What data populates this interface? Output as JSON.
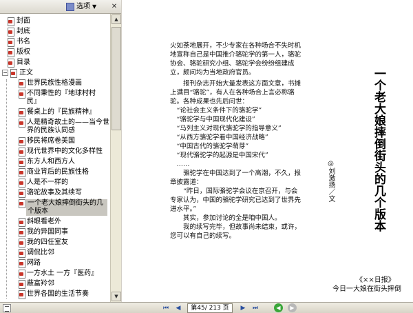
{
  "sidebar": {
    "options_label": "选项",
    "items": [
      {
        "label": "封面"
      },
      {
        "label": "封底"
      },
      {
        "label": "书名"
      },
      {
        "label": "版权"
      },
      {
        "label": "目录"
      },
      {
        "label": "正文"
      },
      {
        "label": "世界民族性格漫画"
      },
      {
        "label": "不同秉性的『地球村村民』"
      },
      {
        "label": "餐桌上的『民族精神』"
      },
      {
        "label": "人是精奇故土的——当今世界的民族认同感"
      },
      {
        "label": "移民将席卷美国"
      },
      {
        "label": "现代世界中的文化多样性"
      },
      {
        "label": "东方人和西方人"
      },
      {
        "label": "商业背后的民族性格"
      },
      {
        "label": "人是不一样的"
      },
      {
        "label": "骆驼故事及其续写"
      },
      {
        "label": "一个老大娘摔倒街头的几个版本"
      },
      {
        "label": "斜眼看老外"
      },
      {
        "label": "我的异国同事"
      },
      {
        "label": "我的四任室友"
      },
      {
        "label": "调侃比邻"
      },
      {
        "label": "网路"
      },
      {
        "label": "一方水土 一方『医药』"
      },
      {
        "label": "蔽富羚邻"
      },
      {
        "label": "世界各国的生活节奏"
      }
    ]
  },
  "document": {
    "paragraphs": [
      {
        "text": "火如荼地展开，不少专家在各种场合不失时机地宣称自己是中国推介骆驼学的第一人，骆驼协会、骆驼研究小组、骆驼学会纷纷组建成立，颇问均为当地政府官员。",
        "style": "plain"
      },
      {
        "text": "报刊杂志开始大量发表这方面文章，书摊上满目“骆驼”，有人在各种场合上言必称骆驼。各种成果也先后问世：",
        "style": "ind"
      },
      {
        "text": "“论社会主义条件下的骆驼学”",
        "style": "q"
      },
      {
        "text": "“骆驼学与中国现代化建设”",
        "style": "q"
      },
      {
        "text": "“马列主义对现代骆驼学的指导意义”",
        "style": "q"
      },
      {
        "text": "“从西方骆驼学看中国经济战略”",
        "style": "q"
      },
      {
        "text": "“中国古代的骆驼学萌芽”",
        "style": "q"
      },
      {
        "text": "“现代骆驼学的起源是中国宋代”",
        "style": "q"
      },
      {
        "text": "……",
        "style": "q"
      },
      {
        "text": "骆驼学在中国达到了一个高潮，不久，报章披露道：",
        "style": "ind"
      },
      {
        "text": "“昨日，国际骆驼学会议在京召开，与会专家认为，中国的骆驼学研究已达到了世界先进水平。”",
        "style": "ind"
      },
      {
        "text": "其实，参加讨论的全是咱中国人。",
        "style": "ind"
      },
      {
        "text": "我的续写完毕，但故事尚未结束，或许，您可以有自己的续写。",
        "style": "ind"
      }
    ],
    "title": "一个老大娘摔倒街头的几个版本",
    "byline": "◎刘激扬／文",
    "source": "《××日报》",
    "subnote": "今日一大娘在街头摔倒"
  },
  "statusbar": {
    "page_indicator": "第45/ 213 页",
    "first_icon": "first-page-icon",
    "prev_icon": "prev-page-icon",
    "next_icon": "next-page-icon",
    "last_icon": "last-page-icon"
  },
  "colors": {
    "chrome": "#d4d0c8",
    "selection": "#c8c6bf",
    "pdf_icon": "#c9362b",
    "nav_blue": "#2a4f9e",
    "go_green": "#3aa63a"
  }
}
